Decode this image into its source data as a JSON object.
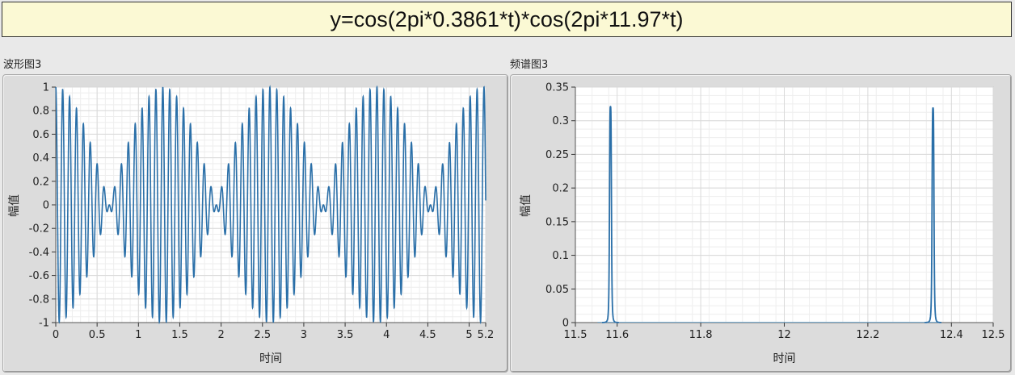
{
  "formula": "y=cos(2pi*0.3861*t)*cos(2pi*11.97*t)",
  "panels": {
    "waveform": {
      "label": "波形图3"
    },
    "spectrum": {
      "label": "频谱图3"
    }
  },
  "chart_data": [
    {
      "type": "line",
      "title": "波形图3",
      "xlabel": "时间",
      "ylabel": "幅值",
      "xlim": [
        0,
        5.2
      ],
      "ylim": [
        -1,
        1
      ],
      "xticks": [
        0,
        0.5,
        1,
        1.5,
        2,
        2.5,
        3,
        3.5,
        4,
        4.5,
        5,
        5.2
      ],
      "yticks": [
        -1,
        -0.8,
        -0.6,
        -0.4,
        -0.2,
        0,
        0.2,
        0.4,
        0.6,
        0.8,
        1
      ],
      "grid": true,
      "color": "#2a6fa8",
      "series": [
        {
          "function": "cos(2*pi*0.3861*t)*cos(2*pi*11.97*t)",
          "f_env": 0.3861,
          "f_carrier": 11.97,
          "t_range": [
            0,
            5.2
          ]
        }
      ]
    },
    {
      "type": "line",
      "title": "频谱图3",
      "xlabel": "时间",
      "ylabel": "幅值",
      "xlim": [
        11.5,
        12.5
      ],
      "ylim": [
        0,
        0.35
      ],
      "xticks": [
        11.5,
        11.6,
        11.8,
        12,
        12.2,
        12.4,
        12.5
      ],
      "yticks": [
        0,
        0.05,
        0.1,
        0.15,
        0.2,
        0.25,
        0.3,
        0.35
      ],
      "grid": true,
      "color": "#2a6fa8",
      "baseline_range": [
        11.553,
        12.375
      ],
      "series": [
        {
          "peaks": [
            {
              "x": 11.584,
              "y": 0.321
            },
            {
              "x": 12.356,
              "y": 0.319
            }
          ]
        }
      ]
    }
  ]
}
